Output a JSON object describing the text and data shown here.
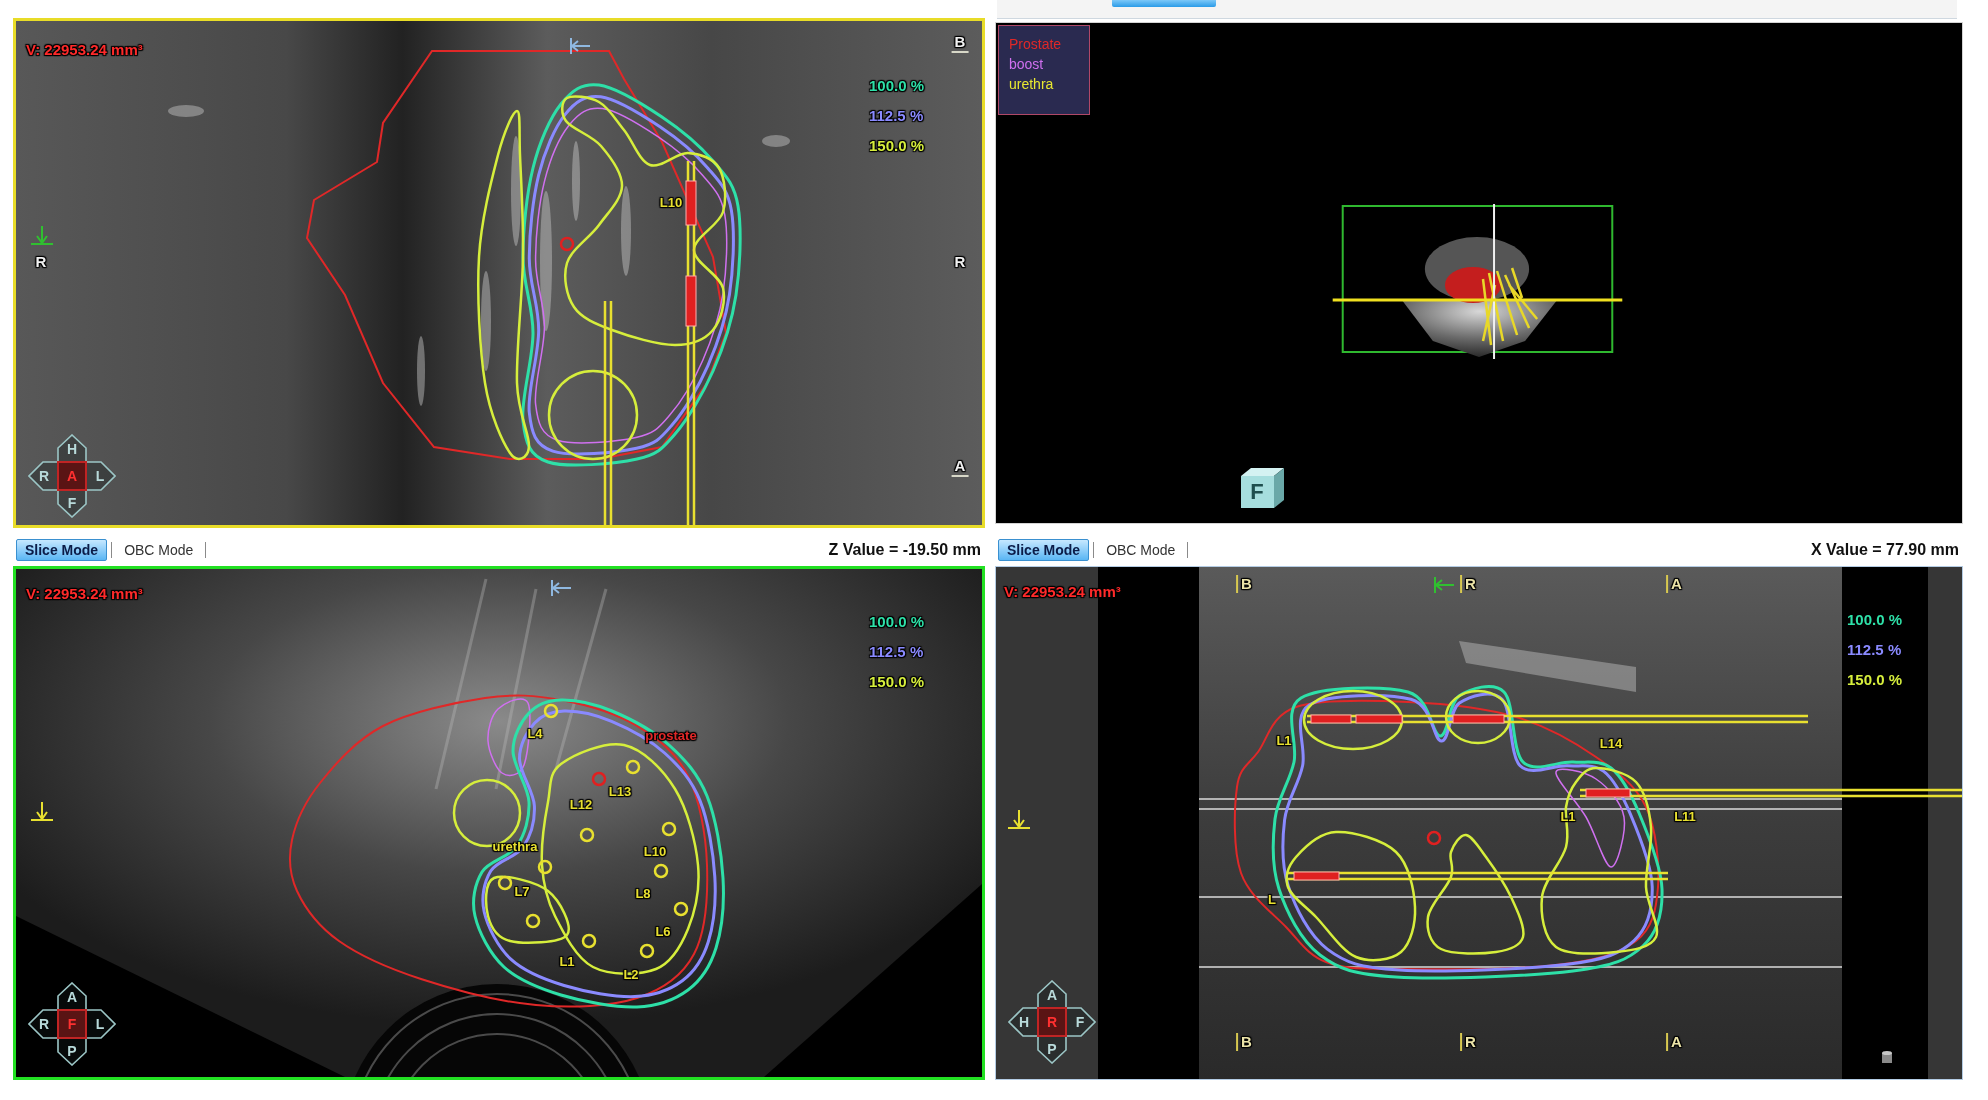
{
  "views": [
    {
      "kind": "coronal",
      "color": "#e8dc28",
      "volume": "V: 22953.24 mm³",
      "isodose_legend": [
        {
          "label": "100.0 %",
          "color": "#2ee0a8"
        },
        {
          "label": "112.5 %",
          "color": "#8a8aff"
        },
        {
          "label": "150.0 %",
          "color": "#d6ee3c"
        }
      ],
      "orientation_labels": [
        "B",
        "R",
        "R",
        "A"
      ],
      "labels": [
        {
          "text": "L10",
          "color": "#e8e030"
        }
      ],
      "compass": [
        "H",
        "R",
        "A",
        "L",
        "F"
      ]
    },
    {
      "kind": "render3d",
      "color": "#d4d4d4",
      "structure_legend": [
        {
          "label": "Prostate",
          "color": "#e02828"
        },
        {
          "label": "boost",
          "color": "#d070f0"
        },
        {
          "label": "urethra",
          "color": "#e8e830"
        }
      ],
      "cube_label": "F"
    },
    {
      "kind": "axial",
      "color": "#22e022",
      "toolbar": {
        "tabs": [
          {
            "label": "Slice Mode",
            "selected": true
          },
          {
            "label": "OBC Mode",
            "selected": false
          }
        ],
        "value": "Z Value = -19.50 mm"
      },
      "volume": "V: 22953.24 mm³",
      "isodose_legend": [
        {
          "label": "100.0 %",
          "color": "#2ee0a8"
        },
        {
          "label": "112.5 %",
          "color": "#8a8aff"
        },
        {
          "label": "150.0 %",
          "color": "#d6ee3c"
        }
      ],
      "labels": [
        {
          "text": "L4",
          "color": "#e8e030"
        },
        {
          "text": "prostate",
          "color": "#e02828"
        },
        {
          "text": "L12",
          "color": "#e8e030"
        },
        {
          "text": "L13",
          "color": "#e8e030"
        },
        {
          "text": "urethra",
          "color": "#e8e030"
        },
        {
          "text": "L10",
          "color": "#e8e030"
        },
        {
          "text": "L8",
          "color": "#e8e030"
        },
        {
          "text": "L6",
          "color": "#e8e030"
        },
        {
          "text": "L1",
          "color": "#e8e030"
        },
        {
          "text": "L2",
          "color": "#e8e030"
        },
        {
          "text": "L7",
          "color": "#e8e030"
        }
      ],
      "compass": [
        "A",
        "R",
        "F",
        "L",
        "P"
      ]
    },
    {
      "kind": "sagittal",
      "color": "#b4cce4",
      "toolbar": {
        "tabs": [
          {
            "label": "Slice Mode",
            "selected": true
          },
          {
            "label": "OBC Mode",
            "selected": false
          }
        ],
        "value": "X Value = 77.90 mm"
      },
      "volume": "V: 22953.24 mm³",
      "isodose_legend": [
        {
          "label": "100.0 %",
          "color": "#2ee0a8"
        },
        {
          "label": "112.5 %",
          "color": "#8a8aff"
        },
        {
          "label": "150.0 %",
          "color": "#d6ee3c"
        }
      ],
      "orientation_labels": [
        "B",
        "R",
        "A",
        "B",
        "R",
        "A"
      ],
      "labels": [
        {
          "text": "L1",
          "color": "#e8e030"
        },
        {
          "text": "L14",
          "color": "#e8e030"
        },
        {
          "text": "L1",
          "color": "#e8e030"
        },
        {
          "text": "L11",
          "color": "#e8e030"
        },
        {
          "text": "L",
          "color": "#e8e030"
        }
      ],
      "compass": [
        "A",
        "H",
        "R",
        "F",
        "P"
      ]
    }
  ]
}
